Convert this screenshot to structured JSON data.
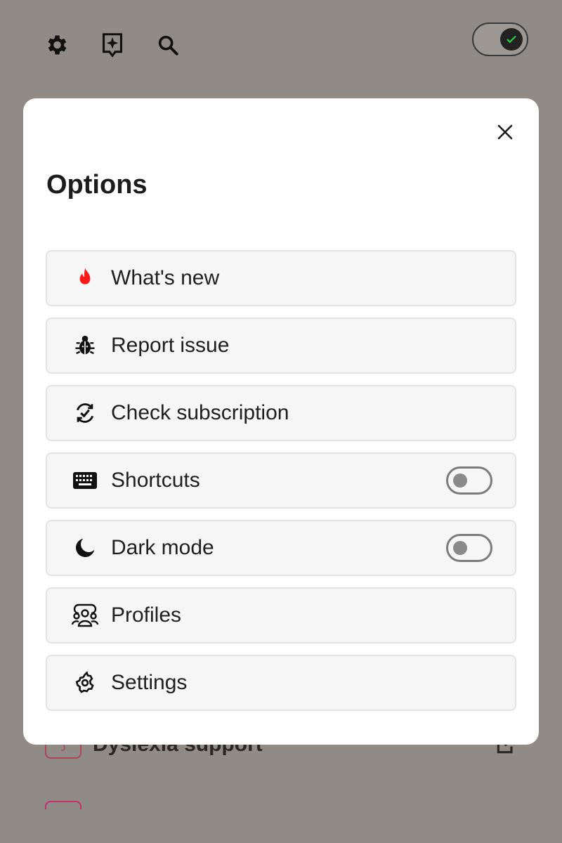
{
  "toolbar": {
    "icons": [
      "gear-icon",
      "sparkle-bookmark-icon",
      "search-icon"
    ],
    "main_toggle_on": true
  },
  "background_list": [
    {
      "label": "Dyslexia support"
    }
  ],
  "modal": {
    "title": "Options",
    "options": [
      {
        "label": "What's new",
        "icon": "flame-icon",
        "has_switch": false
      },
      {
        "label": "Report issue",
        "icon": "bug-icon",
        "has_switch": false
      },
      {
        "label": "Check subscription",
        "icon": "refresh-check-icon",
        "has_switch": false
      },
      {
        "label": "Shortcuts",
        "icon": "keyboard-icon",
        "has_switch": true,
        "switch_on": false
      },
      {
        "label": "Dark mode",
        "icon": "moon-icon",
        "has_switch": true,
        "switch_on": false
      },
      {
        "label": "Profiles",
        "icon": "profiles-icon",
        "has_switch": false
      },
      {
        "label": "Settings",
        "icon": "settings-cog-icon",
        "has_switch": false
      }
    ]
  },
  "colors": {
    "accent_flame": "#ff1a1a",
    "toggle_check": "#2ecc40",
    "backdrop": "#908b87"
  }
}
